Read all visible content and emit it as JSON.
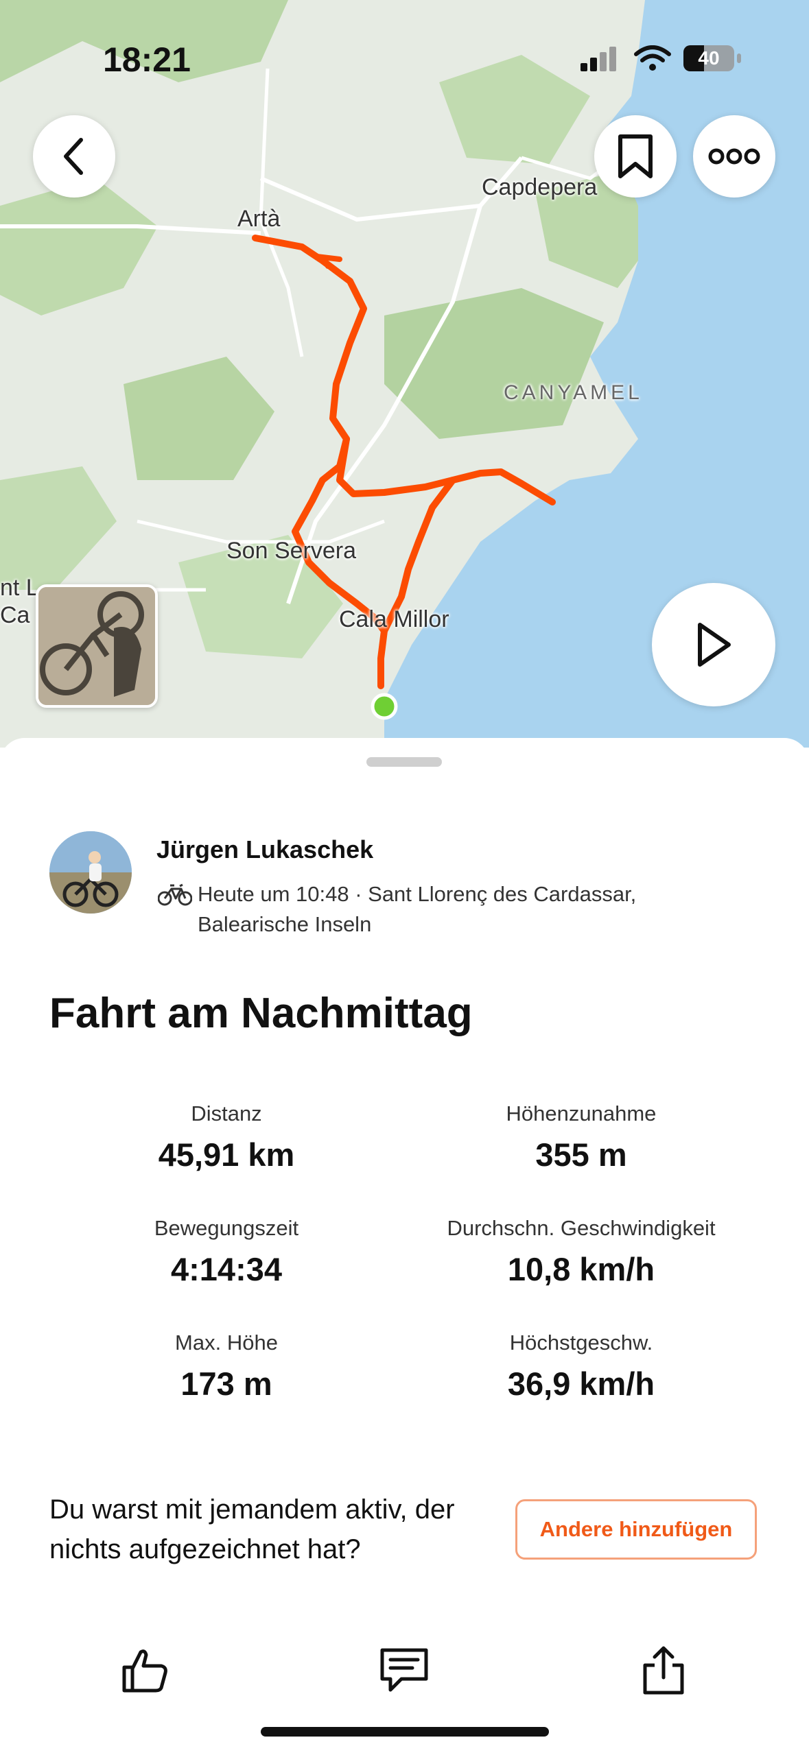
{
  "status_bar": {
    "time": "18:21",
    "battery": "40"
  },
  "map": {
    "labels": {
      "arta": "Artà",
      "capdepera": "Capdepera",
      "canyamel": "CANYAMEL",
      "son_servera": "Son Servera",
      "cala_millor": "Cala Millor",
      "cut_1": "nt L",
      "cut_2": "Ca"
    }
  },
  "activity": {
    "athlete": "Jürgen Lukaschek",
    "meta": "Heute um 10:48 · Sant Llorenç des Cardassar, Balearische Inseln",
    "title": "Fahrt am Nachmittag",
    "stats": [
      {
        "label": "Distanz",
        "value": "45,91 km"
      },
      {
        "label": "Höhenzunahme",
        "value": "355 m"
      },
      {
        "label": "Bewegungszeit",
        "value": "4:14:34"
      },
      {
        "label": "Durchschn. Geschwindigkeit",
        "value": "10,8 km/h"
      },
      {
        "label": "Max. Höhe",
        "value": "173 m"
      },
      {
        "label": "Höchstgeschw.",
        "value": "36,9 km/h"
      }
    ]
  },
  "prompt": {
    "text": "Du warst mit jemandem aktiv, der nichts aufgezeichnet hat?",
    "button": "Andere hinzufügen"
  },
  "colors": {
    "route": "#fc4c02",
    "accent": "#f05a18",
    "water": "#a9d3ef",
    "start_dot": "#6fcf34"
  },
  "icons": [
    "back-icon",
    "bookmark-icon",
    "more-icon",
    "play-icon",
    "bike-icon",
    "kudos-icon",
    "comment-icon",
    "share-icon"
  ]
}
